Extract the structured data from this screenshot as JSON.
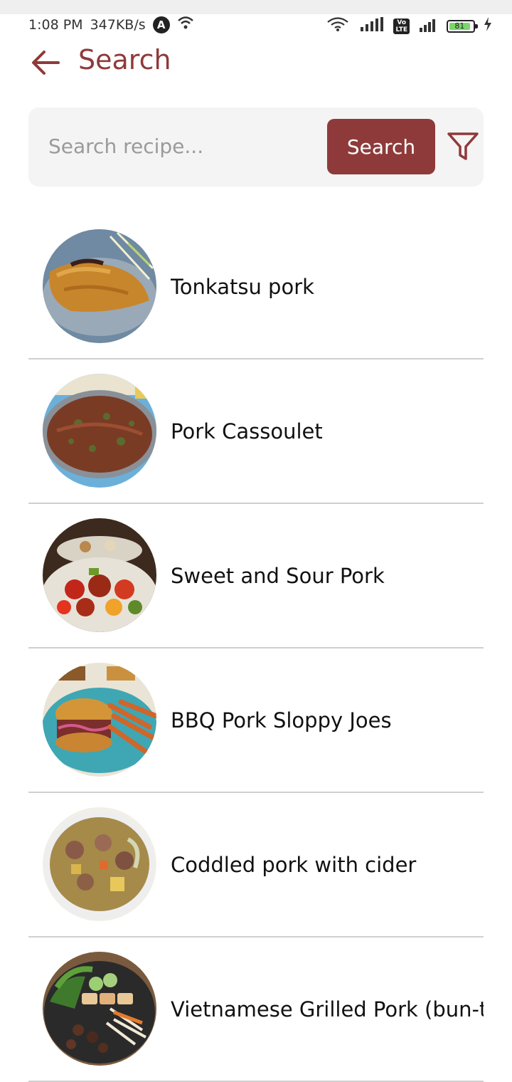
{
  "status_bar": {
    "time": "1:08 PM",
    "speed": "347KB/s",
    "battery": "81"
  },
  "header": {
    "title": "Search",
    "back_icon": "arrow-left-icon"
  },
  "search": {
    "placeholder": "Search recipe...",
    "value": "",
    "button_label": "Search",
    "filter_icon": "filter-icon"
  },
  "recipes": [
    {
      "name": "Tonkatsu pork"
    },
    {
      "name": "Pork Cassoulet"
    },
    {
      "name": "Sweet and Sour Pork"
    },
    {
      "name": "BBQ Pork Sloppy Joes"
    },
    {
      "name": "Coddled pork with cider"
    },
    {
      "name": "Vietnamese Grilled Pork (bun-thit-nuong)"
    }
  ],
  "colors": {
    "accent": "#8f3a3a",
    "card_bg": "#f4f4f4",
    "divider": "#cfcfcf"
  }
}
